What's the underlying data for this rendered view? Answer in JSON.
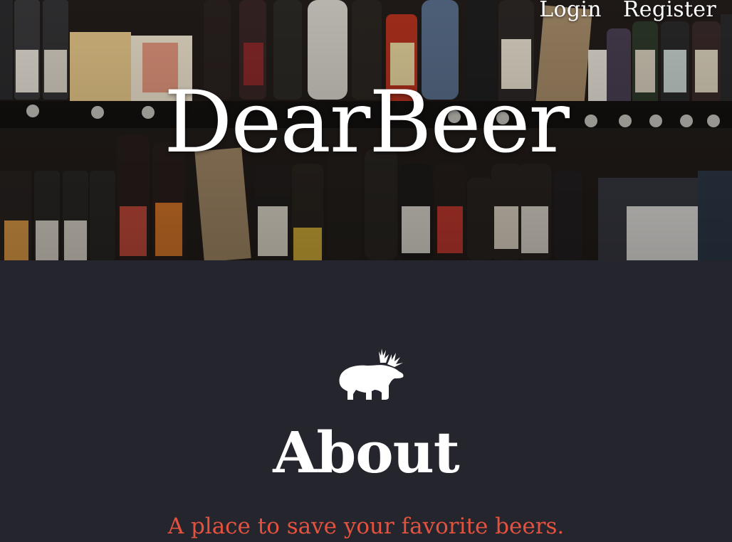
{
  "nav": {
    "login_label": "Login",
    "register_label": "Register"
  },
  "hero": {
    "title": "DearBeer"
  },
  "about": {
    "logo_icon": "bear-with-antlers-icon",
    "title": "About",
    "tagline": "A place to save your favorite beers."
  },
  "colors": {
    "background": "#25252e",
    "accent": "#e4523f",
    "text": "#ffffff"
  }
}
